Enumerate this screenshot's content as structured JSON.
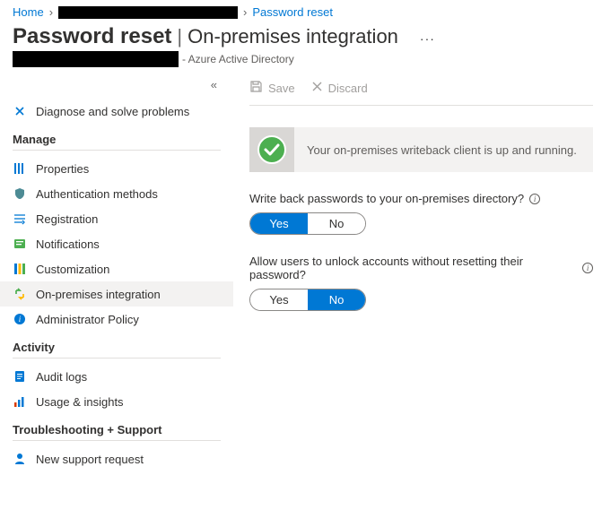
{
  "breadcrumb": {
    "home": "Home",
    "current": "Password reset"
  },
  "header": {
    "title_main": "Password reset",
    "title_sub": "On-premises integration",
    "ellipsis": "···",
    "subtitle_suffix": "- Azure Active Directory"
  },
  "sidebar": {
    "collapse": "«",
    "diagnose": "Diagnose and solve problems",
    "section_manage": "Manage",
    "properties": "Properties",
    "auth_methods": "Authentication methods",
    "registration": "Registration",
    "notifications": "Notifications",
    "customization": "Customization",
    "onprem": "On-premises integration",
    "admin_policy": "Administrator Policy",
    "section_activity": "Activity",
    "audit_logs": "Audit logs",
    "usage": "Usage & insights",
    "section_ts": "Troubleshooting + Support",
    "support": "New support request"
  },
  "toolbar": {
    "save": "Save",
    "discard": "Discard"
  },
  "status": {
    "text": "Your on-premises writeback client is up and running."
  },
  "setting1": {
    "label": "Write back passwords to your on-premises directory?",
    "yes": "Yes",
    "no": "No",
    "value": "yes"
  },
  "setting2": {
    "label": "Allow users to unlock accounts without resetting their password?",
    "yes": "Yes",
    "no": "No",
    "value": "no"
  }
}
